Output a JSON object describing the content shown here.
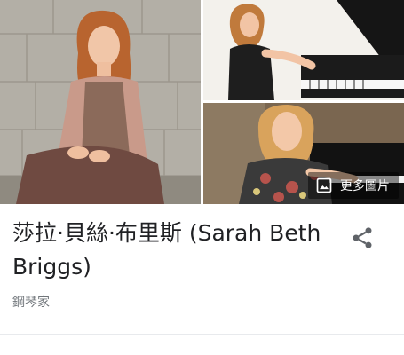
{
  "images": {
    "main_alt": "Sarah Beth Briggs portrait",
    "top_alt": "Pianist at grand piano",
    "bottom_alt": "Pianist smiling at piano",
    "more_images_label": "更多圖片",
    "more_images_icon": "image-icon"
  },
  "entity": {
    "title": "莎拉·貝絲·布里斯 (Sarah Beth Briggs)",
    "subtitle": "鋼琴家",
    "share_icon": "share-icon"
  },
  "colors": {
    "title": "#202124",
    "subtitle": "#70757a",
    "icon": "#5f6368"
  }
}
